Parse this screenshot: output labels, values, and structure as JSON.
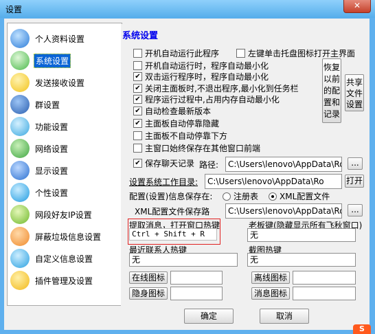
{
  "window": {
    "title": "设置",
    "close": "✕"
  },
  "sidebar": {
    "items": [
      {
        "label": "个人资料设置",
        "icon": "person-icon",
        "color": "#2b7bd8"
      },
      {
        "label": "系统设置",
        "icon": "system-settings-icon",
        "color": "#48b848",
        "selected": true
      },
      {
        "label": "发送接收设置",
        "icon": "send-receive-icon",
        "color": "#f2c21a"
      },
      {
        "label": "群设置",
        "icon": "group-icon",
        "color": "#2a5fb0"
      },
      {
        "label": "功能设置",
        "icon": "function-icon",
        "color": "#3aa8e0"
      },
      {
        "label": "网络设置",
        "icon": "network-icon",
        "color": "#3da540"
      },
      {
        "label": "显示设置",
        "icon": "display-icon",
        "color": "#2a6fd0"
      },
      {
        "label": "个性设置",
        "icon": "personalize-icon",
        "color": "#1f9be0"
      },
      {
        "label": "网段好友IP设置",
        "icon": "ip-segment-icon",
        "color": "#6fb82a"
      },
      {
        "label": "屏蔽垃圾信息设置",
        "icon": "block-spam-icon",
        "color": "#f08a2c"
      },
      {
        "label": "自定义信息设置",
        "icon": "custom-info-icon",
        "color": "#2aa0e0"
      },
      {
        "label": "插件管理及设置",
        "icon": "plugin-icon",
        "color": "#f2b818"
      }
    ]
  },
  "panel": {
    "title": "系统设置",
    "options": {
      "autostart": {
        "label": "开机自动运行此程序",
        "checked": false
      },
      "left_click_tray": {
        "label": "左键单击托盘图标打开主界面",
        "checked": false
      },
      "autostart_min": {
        "label": "开机自动运行时，程序自动最小化",
        "checked": false
      },
      "dblclick_min": {
        "label": "双击运行程序时，程序自动最小化",
        "checked": true
      },
      "close_min": {
        "label": "关闭主面板时,不退出程序,最小化到任务栏",
        "checked": true
      },
      "memory_min": {
        "label": "程序运行过程中,占用内存自动最小化",
        "checked": true
      },
      "auto_update": {
        "label": "自动检查最新版本",
        "checked": true
      },
      "auto_hide": {
        "label": "主面板自动停靠隐藏",
        "checked": true
      },
      "no_dock_bottom": {
        "label": "主面板不自动停靠下方",
        "checked": false
      },
      "always_top": {
        "label": "主窗口始终保存在其他窗口前端",
        "checked": false
      },
      "save_history": {
        "label": "保存聊天记录",
        "checked": true
      }
    },
    "restore_button": "恢复以前的配置和记录",
    "share_button": "共享文件设置",
    "path_label": "路径:",
    "path_value": "C:\\Users\\lenovo\\AppData\\Ro",
    "browse": "...",
    "workdir_label": "设置系统工作目录:",
    "workdir_value": "C:\\Users\\lenovo\\AppData\\Ro",
    "open_button": "打开",
    "config_save_label": "配置(设置)信息保存在:",
    "radio_registry": "注册表",
    "radio_xml": "XML配置文件",
    "xml_selected": true,
    "xml_path_label": "XML配置文件保存路",
    "xml_path_value": "C:\\Users\\lenovo\\AppData\\Ro",
    "hotkey_extract_label": "提取消息，打开窗口热键",
    "hotkey_extract_value": "Ctrl + Shift + R",
    "boss_key_label": "老板键(隐藏显示所有飞秋窗口)",
    "boss_key_value": "无",
    "recent_contact_label": "最近联系人热键",
    "recent_contact_value": "无",
    "screenshot_label": "截图热键",
    "screenshot_value": "无",
    "online_icon": "在线图标",
    "offline_icon": "离线图标",
    "hidden_icon": "隐身图标",
    "message_icon": "消息图标"
  },
  "footer": {
    "ok": "确定",
    "cancel": "取消"
  },
  "ime": {
    "label": "S"
  }
}
